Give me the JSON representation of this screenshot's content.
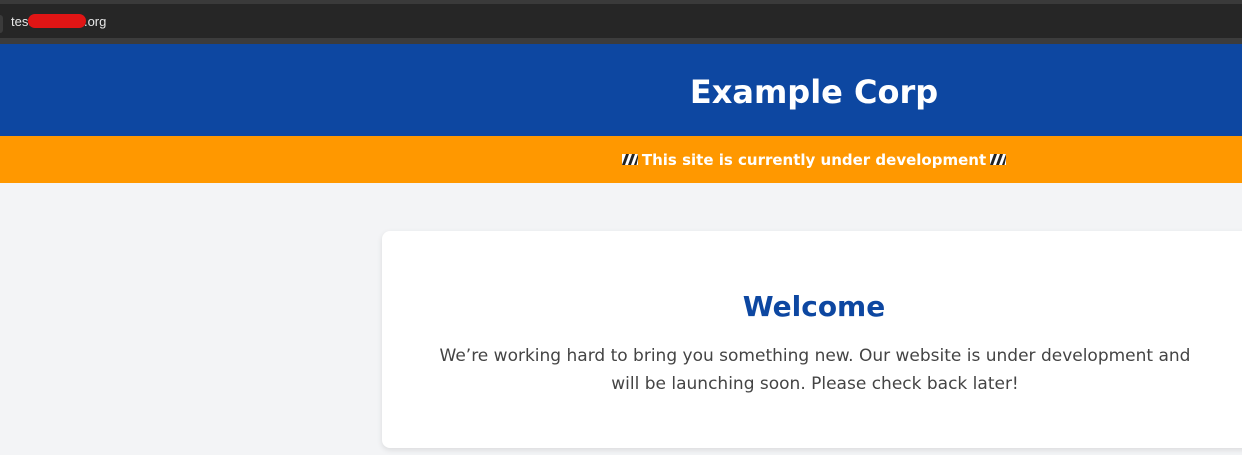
{
  "browser": {
    "url_start": "test",
    "url_end": ".org",
    "url_redacted": true
  },
  "header": {
    "title": "Example Corp",
    "background_color": "#0d47a1"
  },
  "banner": {
    "icon": "construction-icon",
    "text": "This site is currently under development",
    "background_color": "#ff9800"
  },
  "main": {
    "heading": "Welcome",
    "body": "We’re working hard to bring you something new. Our website is under development and will be launching soon. Please check back later!",
    "heading_color": "#0d47a1"
  }
}
